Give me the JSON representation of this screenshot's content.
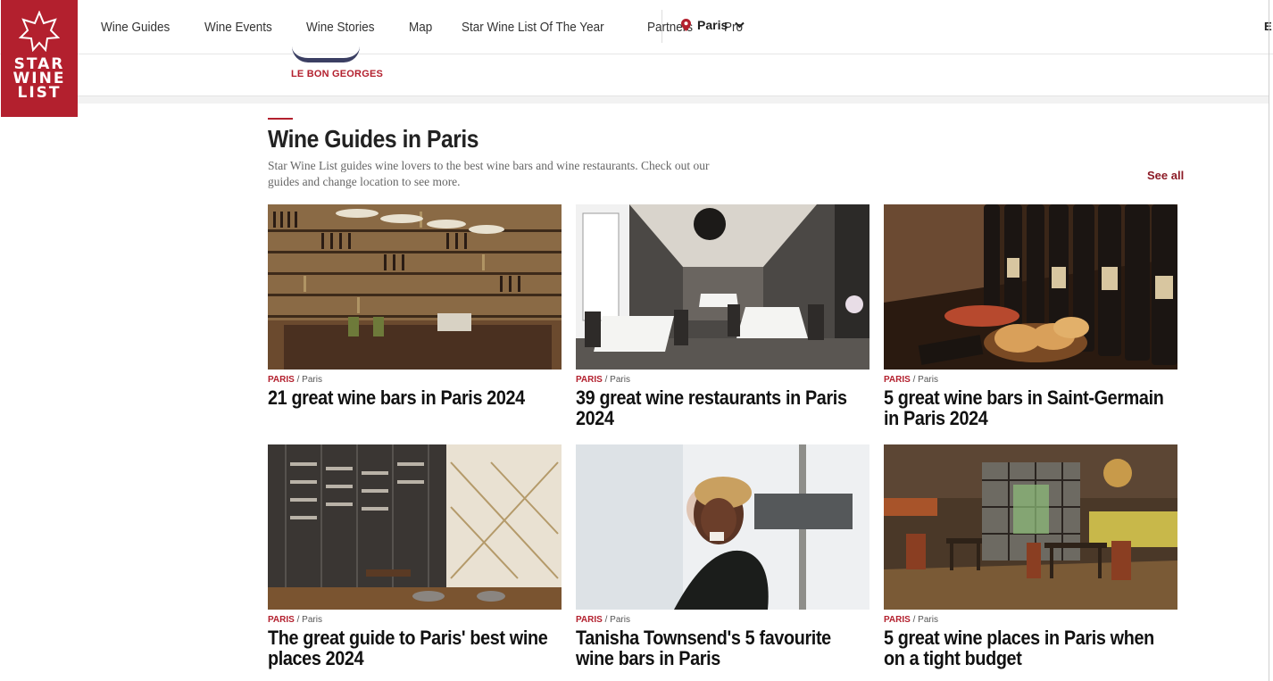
{
  "brand": {
    "logo_line1": "STAR",
    "logo_line2": "WINE",
    "logo_line3": "LIST",
    "color": "#b3202e"
  },
  "nav": {
    "items": [
      "Wine Guides",
      "Wine Events",
      "Wine Stories",
      "Map",
      "Star Wine List Of The Year",
      "Partners",
      "Pro"
    ],
    "location_label": "Paris",
    "right_edge_char": "E"
  },
  "partial": {
    "restaurant_name": "LE BON GEORGES"
  },
  "section": {
    "title": "Wine Guides in Paris",
    "description": "Star Wine List guides wine lovers to the best wine bars and wine restaurants. Check out our guides and change location to see more.",
    "see_all": "See all"
  },
  "cards": [
    {
      "location": "PARIS",
      "sublocation": "Paris",
      "title": "21 great wine bars in Paris 2024",
      "image": "wine-shop-shelves"
    },
    {
      "location": "PARIS",
      "sublocation": "Paris",
      "title": "39 great wine restaurants in Paris 2024",
      "image": "restaurant-dining-room"
    },
    {
      "location": "PARIS",
      "sublocation": "Paris",
      "title": "5 great wine bars in Saint-Germain in Paris 2024",
      "image": "wine-bottles-bread"
    },
    {
      "location": "PARIS",
      "sublocation": "Paris",
      "title": "The great guide to Paris' best wine places 2024",
      "image": "wine-cellar-glass"
    },
    {
      "location": "PARIS",
      "sublocation": "Paris",
      "title": "Tanisha Townsend's 5 favourite wine bars in Paris",
      "image": "portrait-woman"
    },
    {
      "location": "PARIS",
      "sublocation": "Paris",
      "title": "5 great wine places in Paris when on a tight budget",
      "image": "cosy-wine-bar"
    }
  ]
}
